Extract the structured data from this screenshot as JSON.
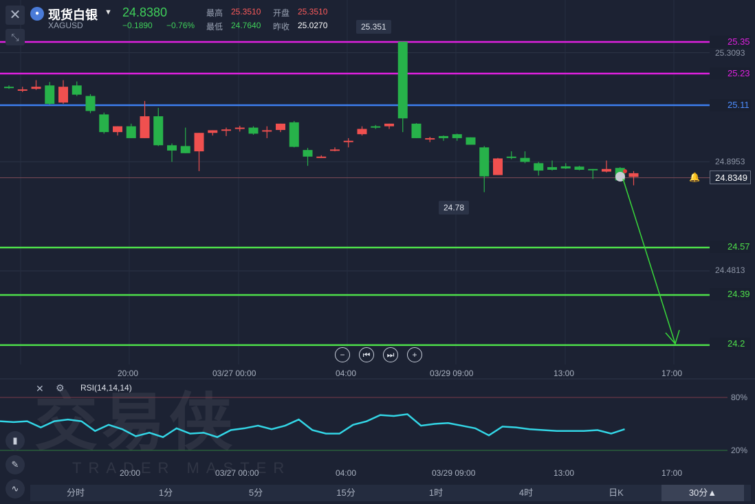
{
  "header": {
    "symbol_name": "现货白银",
    "symbol_code": "XAGUSD",
    "last_price": "24.8380",
    "change": "−0.1890",
    "change_pct": "−0.76%",
    "high_label": "最高",
    "high_value": "25.3510",
    "open_label": "开盘",
    "open_value": "25.3510",
    "low_label": "最低",
    "low_value": "24.7640",
    "prev_close_label": "昨收",
    "prev_close_value": "25.0270"
  },
  "price_axis": {
    "ticks": [
      "25.3093",
      "24.8953",
      "24.4813"
    ],
    "current_price": "24.8349"
  },
  "levels": [
    {
      "label": "25.35",
      "value": 25.35,
      "color": "#e020e0"
    },
    {
      "label": "25.23",
      "value": 25.23,
      "color": "#e020e0"
    },
    {
      "label": "25.11",
      "value": 25.11,
      "color": "#3d7ff0"
    },
    {
      "label": "24.57",
      "value": 24.57,
      "color": "#4ee04a"
    },
    {
      "label": "24.39",
      "value": 24.39,
      "color": "#4ee04a"
    },
    {
      "label": "24.2",
      "value": 24.2,
      "color": "#4ee04a"
    }
  ],
  "callouts": {
    "high": "25.351",
    "low": "24.78"
  },
  "time_axis": [
    "20:00",
    "03/27 00:00",
    "04:00",
    "03/29 09:00",
    "13:00",
    "17:00"
  ],
  "rsi": {
    "label": "RSI(14,14,14)",
    "upper": "80%",
    "lower": "20%",
    "values": [
      53,
      52,
      53,
      46,
      53,
      55,
      53,
      42,
      49,
      44,
      36,
      40,
      35,
      45,
      39,
      40,
      35,
      43,
      45,
      48,
      44,
      48,
      55,
      43,
      39,
      39,
      49,
      53,
      60,
      59,
      61,
      48,
      50,
      51,
      48,
      45,
      37,
      47,
      46,
      44,
      43,
      42,
      42,
      42,
      43,
      39,
      44
    ]
  },
  "timeframes": [
    "分时",
    "1分",
    "5分",
    "15分",
    "1时",
    "4时",
    "日K",
    "30分▲"
  ],
  "active_timeframe": "30分▲",
  "watermark": {
    "zh": "交易侠",
    "en": "TRADER MASTER"
  },
  "colors": {
    "up": "#f0504f",
    "down": "#27b24a",
    "rsi": "#33d6e6",
    "background": "#1c2233"
  },
  "chart_data": {
    "type": "candlestick",
    "title": "",
    "symbol": "XAGUSD",
    "timeframe": "30分",
    "ylim": [
      24.12,
      25.42
    ],
    "candles": [
      {
        "o": 25.18,
        "h": 25.185,
        "c": 25.175,
        "l": 25.172
      },
      {
        "o": 25.165,
        "h": 25.18,
        "c": 25.17,
        "l": 25.16
      },
      {
        "o": 25.172,
        "h": 25.205,
        "c": 25.18,
        "l": 25.168
      },
      {
        "o": 25.185,
        "h": 25.198,
        "c": 25.115,
        "l": 25.112
      },
      {
        "o": 25.12,
        "h": 25.205,
        "c": 25.18,
        "l": 25.115
      },
      {
        "o": 25.185,
        "h": 25.2,
        "c": 25.15,
        "l": 25.145
      },
      {
        "o": 25.145,
        "h": 25.152,
        "c": 25.088,
        "l": 25.08
      },
      {
        "o": 25.075,
        "h": 25.082,
        "c": 25.008,
        "l": 25.002
      },
      {
        "o": 25.008,
        "h": 25.03,
        "c": 25.03,
        "l": 24.995
      },
      {
        "o": 25.03,
        "h": 25.04,
        "c": 24.985,
        "l": 24.985
      },
      {
        "o": 24.985,
        "h": 25.126,
        "c": 25.068,
        "l": 24.985
      },
      {
        "o": 25.068,
        "h": 25.1,
        "c": 24.958,
        "l": 24.955
      },
      {
        "o": 24.958,
        "h": 24.965,
        "c": 24.938,
        "l": 24.895
      },
      {
        "o": 24.955,
        "h": 25.025,
        "c": 24.928,
        "l": 24.928
      },
      {
        "o": 24.935,
        "h": 25.002,
        "c": 25.005,
        "l": 24.86
      },
      {
        "o": 25.005,
        "h": 25.01,
        "c": 25.015,
        "l": 24.995
      },
      {
        "o": 25.015,
        "h": 25.025,
        "c": 25.018,
        "l": 24.993
      },
      {
        "o": 25.023,
        "h": 25.032,
        "c": 25.025,
        "l": 25.01
      },
      {
        "o": 25.025,
        "h": 25.03,
        "c": 25.002,
        "l": 24.998
      },
      {
        "o": 25.01,
        "h": 25.03,
        "c": 25.015,
        "l": 24.985
      },
      {
        "o": 25.016,
        "h": 25.038,
        "c": 25.04,
        "l": 25.008
      },
      {
        "o": 25.045,
        "h": 25.05,
        "c": 24.952,
        "l": 24.95
      },
      {
        "o": 24.94,
        "h": 24.948,
        "c": 24.915,
        "l": 24.88
      },
      {
        "o": 24.915,
        "h": 24.92,
        "c": 24.915,
        "l": 24.91
      },
      {
        "o": 24.94,
        "h": 24.95,
        "c": 24.942,
        "l": 24.935
      },
      {
        "o": 24.97,
        "h": 24.985,
        "c": 24.975,
        "l": 24.95
      },
      {
        "o": 25.0,
        "h": 25.03,
        "c": 25.02,
        "l": 24.995
      },
      {
        "o": 25.03,
        "h": 25.035,
        "c": 25.025,
        "l": 25.02
      },
      {
        "o": 25.03,
        "h": 25.04,
        "c": 25.04,
        "l": 25.02
      },
      {
        "o": 25.06,
        "h": 25.351,
        "c": 25.351,
        "l": 25.008
      },
      {
        "o": 25.04,
        "h": 25.042,
        "c": 24.985,
        "l": 24.985
      },
      {
        "o": 24.982,
        "h": 24.99,
        "c": 24.985,
        "l": 24.97
      },
      {
        "o": 24.993,
        "h": 24.995,
        "c": 24.985,
        "l": 24.975
      },
      {
        "o": 25.0,
        "h": 25.002,
        "c": 24.985,
        "l": 24.975
      },
      {
        "o": 24.988,
        "h": 24.975,
        "c": 24.96,
        "l": 24.96
      },
      {
        "o": 24.95,
        "h": 24.955,
        "c": 24.84,
        "l": 24.78
      },
      {
        "o": 24.845,
        "h": 24.91,
        "c": 24.908,
        "l": 24.845
      },
      {
        "o": 24.915,
        "h": 24.935,
        "c": 24.91,
        "l": 24.905
      },
      {
        "o": 24.91,
        "h": 24.935,
        "c": 24.895,
        "l": 24.89
      },
      {
        "o": 24.89,
        "h": 24.895,
        "c": 24.862,
        "l": 24.843
      },
      {
        "o": 24.875,
        "h": 24.9,
        "c": 24.865,
        "l": 24.862
      },
      {
        "o": 24.878,
        "h": 24.89,
        "c": 24.87,
        "l": 24.868
      },
      {
        "o": 24.877,
        "h": 24.88,
        "c": 24.865,
        "l": 24.863
      },
      {
        "o": 24.868,
        "h": 24.868,
        "c": 24.865,
        "l": 24.83
      },
      {
        "o": 24.858,
        "h": 24.9,
        "c": 24.868,
        "l": 24.855
      },
      {
        "o": 24.872,
        "h": 24.875,
        "c": 24.825,
        "l": 24.822
      },
      {
        "o": 24.838,
        "h": 24.86,
        "c": 24.852,
        "l": 24.806
      }
    ],
    "levels": [
      25.35,
      25.23,
      25.11,
      24.57,
      24.39,
      24.2
    ],
    "current_price": 24.8349
  }
}
